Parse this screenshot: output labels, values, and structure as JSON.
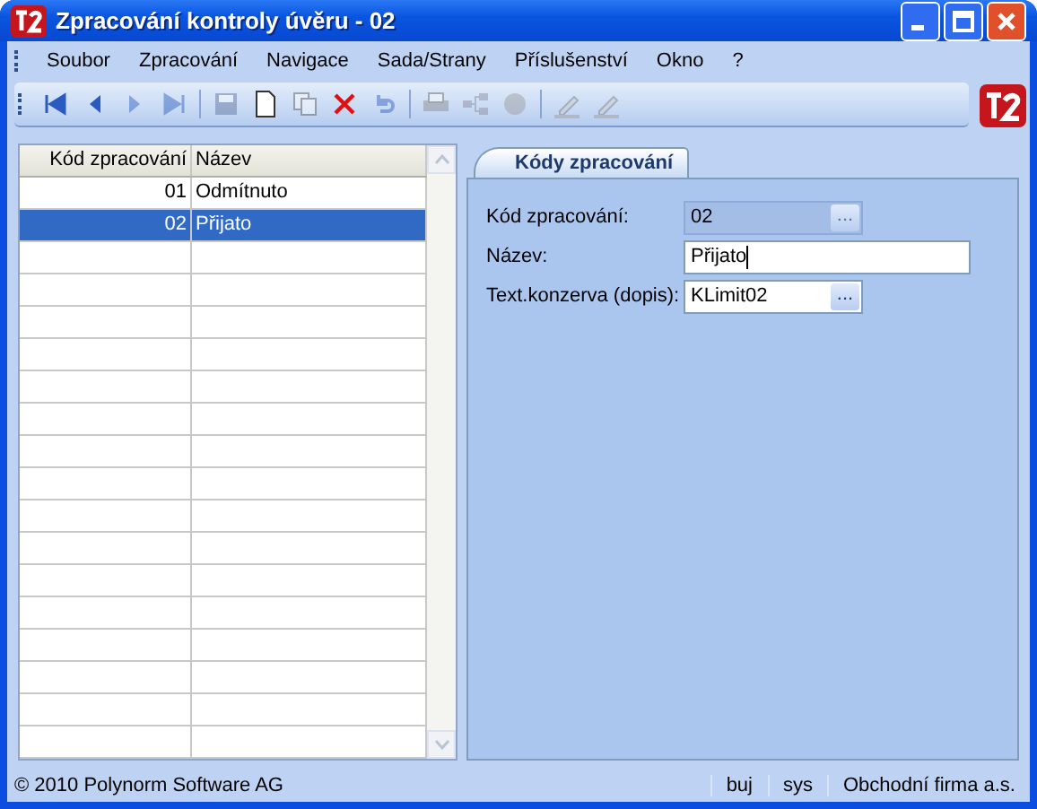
{
  "window": {
    "title": "Zpracování kontroly úvěru - 02"
  },
  "menu": [
    "Soubor",
    "Zpracování",
    "Navigace",
    "Sada/Strany",
    "Příslušenství",
    "Okno",
    "?"
  ],
  "toolbar": [
    {
      "kind": "first",
      "disabled": false
    },
    {
      "kind": "prev",
      "disabled": false
    },
    {
      "kind": "next",
      "disabled": true
    },
    {
      "kind": "last",
      "disabled": true
    },
    {
      "kind": "sep"
    },
    {
      "kind": "save",
      "disabled": true
    },
    {
      "kind": "new",
      "disabled": false
    },
    {
      "kind": "copy",
      "disabled": true
    },
    {
      "kind": "delete",
      "disabled": false
    },
    {
      "kind": "undo",
      "disabled": true
    },
    {
      "kind": "sep"
    },
    {
      "kind": "print",
      "disabled": true
    },
    {
      "kind": "tree",
      "disabled": true
    },
    {
      "kind": "circle",
      "disabled": true
    },
    {
      "kind": "sep"
    },
    {
      "kind": "pen",
      "disabled": true
    },
    {
      "kind": "pen",
      "disabled": true
    }
  ],
  "table": {
    "columns": [
      "Kód zpracování",
      "Název"
    ],
    "rows": [
      {
        "code": "01",
        "name": "Odmítnuto",
        "selected": false
      },
      {
        "code": "02",
        "name": "Přijato",
        "selected": true
      }
    ]
  },
  "tab": {
    "label": "Kódy zpracování",
    "selected": true
  },
  "form": [
    {
      "label": "Kód zpracování:",
      "value": "02",
      "kind": "lookup",
      "button": "...",
      "disabled": true
    },
    {
      "label": "Název:",
      "value": "Přijato",
      "kind": "text",
      "disabled": false
    },
    {
      "label": "Text.konzerva (dopis):",
      "value": "KLimit02",
      "kind": "lookup",
      "button": "...",
      "disabled": false
    }
  ],
  "status_bar": [
    "© 2010 Polynorm Software AG",
    "buj",
    "sys",
    "Obchodní firma a.s."
  ]
}
